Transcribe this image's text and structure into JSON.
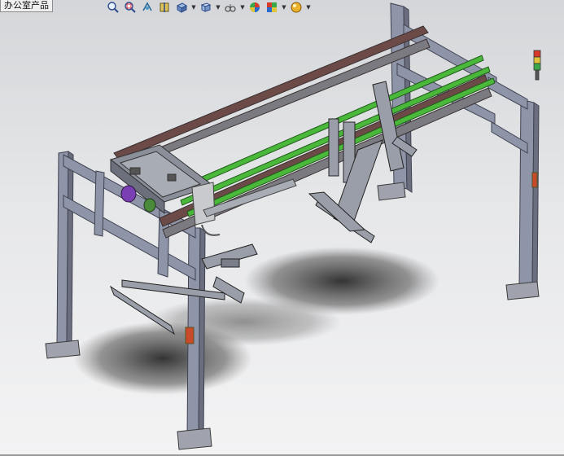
{
  "window": {
    "tab_label": "办公室产品"
  },
  "toolbar": {
    "buttons": [
      {
        "icon": "zoom-to-fit-icon",
        "has_menu": false
      },
      {
        "icon": "zoom-to-area-icon",
        "has_menu": false
      },
      {
        "icon": "previous-view-icon",
        "has_menu": false
      },
      {
        "icon": "section-view-icon",
        "has_menu": false
      },
      {
        "icon": "view-orientation-icon",
        "has_menu": true
      },
      {
        "icon": "display-style-icon",
        "has_menu": true
      },
      {
        "icon": "hide-show-items-icon",
        "has_menu": true
      },
      {
        "icon": "edit-appearance-icon",
        "has_menu": false
      },
      {
        "icon": "apply-scene-icon",
        "has_menu": true
      },
      {
        "icon": "view-settings-icon",
        "has_menu": true
      }
    ]
  },
  "model": {
    "signal_tower_colors": [
      "#d83a2a",
      "#e0c53a",
      "#3aa84a"
    ],
    "frame_color": "#8f95a8",
    "rail_color": "#4ab83a",
    "motor_color": "#7a3fb3"
  }
}
